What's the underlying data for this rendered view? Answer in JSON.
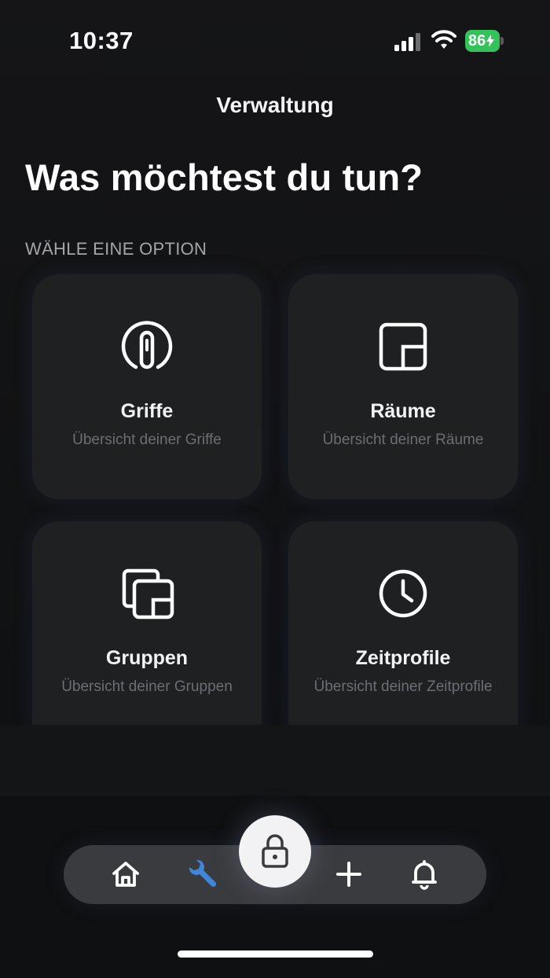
{
  "status_bar": {
    "time": "10:37",
    "battery_level": "86",
    "battery_color": "#33c35a",
    "icons": [
      "signal-icon",
      "wifi-icon",
      "battery-charging-icon"
    ]
  },
  "header": {
    "nav_title": "Verwaltung",
    "page_title": "Was möchtest du tun?",
    "section_label": "WÄHLE EINE OPTION"
  },
  "options": [
    {
      "title": "Griffe",
      "subtitle": "Übersicht deiner Griffe",
      "icon": "handle-icon"
    },
    {
      "title": "Räume",
      "subtitle": "Übersicht deiner Räume",
      "icon": "room-icon"
    },
    {
      "title": "Gruppen",
      "subtitle": "Übersicht deiner Gruppen",
      "icon": "groups-icon"
    },
    {
      "title": "Zeitprofile",
      "subtitle": "Übersicht deiner Zeitprofile",
      "icon": "clock-icon"
    }
  ],
  "tab_bar": {
    "items": [
      {
        "id": "home",
        "icon": "home-icon",
        "active": false
      },
      {
        "id": "admin",
        "icon": "wrench-icon",
        "active": true
      },
      {
        "id": "add",
        "icon": "plus-icon",
        "active": false
      },
      {
        "id": "notifications",
        "icon": "bell-icon",
        "active": false
      }
    ],
    "center_button_icon": "lock-icon",
    "active_color": "#3f86d8"
  }
}
